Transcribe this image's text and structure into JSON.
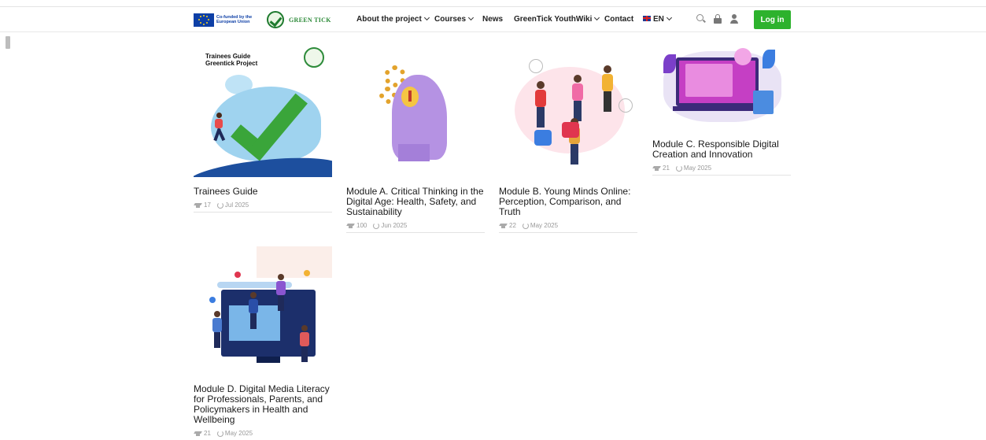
{
  "header": {
    "eu_text": "Co-funded by the European Union",
    "brand_name": "GREEN TICK",
    "nav": [
      {
        "label": "About the project",
        "dropdown": true
      },
      {
        "label": "Courses",
        "dropdown": true
      },
      {
        "label": "News",
        "dropdown": false
      },
      {
        "label": "GreenTick YouthWiki",
        "dropdown": true
      },
      {
        "label": "Contact",
        "dropdown": false
      }
    ],
    "language": "EN",
    "icons": [
      "search-icon",
      "lock-icon",
      "user-icon"
    ],
    "login_label": "Log in",
    "login_color": "#2db22d"
  },
  "courses": [
    {
      "title": "Trainees Guide",
      "students": "17",
      "updated": "Jul 2025",
      "thumb_text": "Trainees Guide\nGreentick Project"
    },
    {
      "title": "Module A. Critical Thinking in the Digital Age: Health, Safety, and Sustainability",
      "students": "100",
      "updated": "Jun 2025"
    },
    {
      "title": "Module B. Young Minds Online: Perception, Comparison, and Truth",
      "students": "22",
      "updated": "May 2025"
    },
    {
      "title": "Module C. Responsible Digital Creation and Innovation",
      "students": "21",
      "updated": "May 2025"
    },
    {
      "title": "Module D. Digital Media Literacy for Professionals, Parents, and Policymakers in Health and Wellbeing",
      "students": "21",
      "updated": "May 2025"
    }
  ]
}
